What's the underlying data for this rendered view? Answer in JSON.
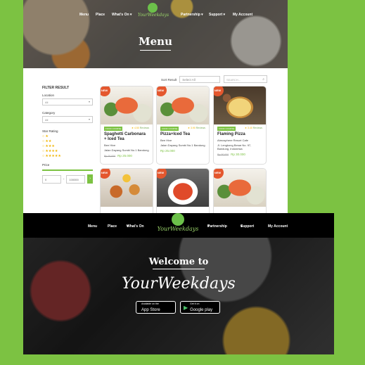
{
  "screen1": {
    "nav": {
      "menu": "Menu",
      "place": "Place",
      "whats_on": "What's On",
      "partnership": "Partnership",
      "support": "Support",
      "my_account": "My Account"
    },
    "logo_text": "YourWeekdays",
    "hero_title": "Menu",
    "sort": {
      "label": "Sort Result",
      "value": "Select All"
    },
    "search_placeholder": "SEARCH...",
    "filter": {
      "title": "FILTER RESULT",
      "location_label": "Location",
      "location_value": "All",
      "category_label": "Category",
      "category_value": "All",
      "star_label": "Star Rating",
      "price_label": "Price",
      "price_min": "0",
      "price_max": "100000"
    },
    "cards": [
      {
        "badge": "NEW",
        "tag": "FOOD COURSE",
        "rating": "4.50",
        "reviews": "Reviews",
        "name": "Spaghetti Carbonara + Iced Tea",
        "place": "Bee Hive",
        "address": "Jalan Dayang Sumbi No.1 Bandung",
        "old_price": "Rp.30,000",
        "price": "Rp 25.000"
      },
      {
        "badge": "NEW",
        "tag": "FOOD COURSE",
        "rating": "3.90",
        "reviews": "Reviews",
        "name": "Pizza+Iced Tea",
        "place": "Bee Hive",
        "address": "Jalan Dayang Sumbi No.1 Bandung",
        "old_price": "",
        "price": "Rp 25.000"
      },
      {
        "badge": "NEW",
        "tag": "FOOD COURSE",
        "rating": "3.40",
        "reviews": "Reviews",
        "name": "Flaming Pizza",
        "place": "Atmosphere Resort Cafe",
        "address": "Jl. Lengkong Besar No. 97, Bandung, Indonesia",
        "old_price": "Rp.50,000",
        "price": "Rp 30.000"
      },
      {
        "badge": "NEW"
      },
      {
        "badge": "NEW"
      },
      {
        "badge": "NEW"
      }
    ]
  },
  "screen2": {
    "nav": {
      "menu": "Menu",
      "place": "Place",
      "whats_on": "What's On",
      "partnership": "Partnership",
      "support": "Support",
      "my_account": "My Account"
    },
    "logo_text": "YourWeekdays",
    "welcome": "Welcome to",
    "brand": "YourWeekdays",
    "app_store": {
      "small": "Available on the",
      "big": "App Store"
    },
    "google_play": {
      "small": "Get it on",
      "big": "Google play"
    }
  },
  "colors": {
    "brand_green": "#7cc242",
    "badge_red": "#e4572e",
    "star_gold": "#f0b400"
  }
}
